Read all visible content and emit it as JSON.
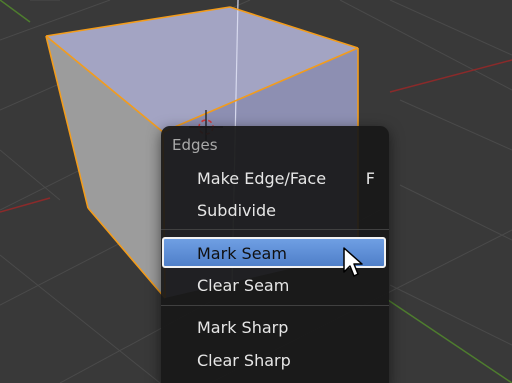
{
  "viewport": {
    "background_color": "#393939",
    "selection_color": "#f39c1b",
    "cursor_icon": "crosshair-3d-cursor-icon"
  },
  "edges_menu": {
    "title": "Edges",
    "items": [
      {
        "label": "Make Edge/Face",
        "shortcut": "F",
        "highlighted": false
      },
      {
        "label": "Subdivide",
        "highlighted": false
      },
      {
        "label": "Mark Seam",
        "highlighted": true
      },
      {
        "label": "Clear Seam",
        "highlighted": false
      },
      {
        "label": "Mark Sharp",
        "highlighted": false
      },
      {
        "label": "Clear Sharp",
        "highlighted": false
      }
    ],
    "highlight_color": "#5b8ed8"
  },
  "mouse_cursor": {
    "icon": "arrow-pointer-icon"
  }
}
